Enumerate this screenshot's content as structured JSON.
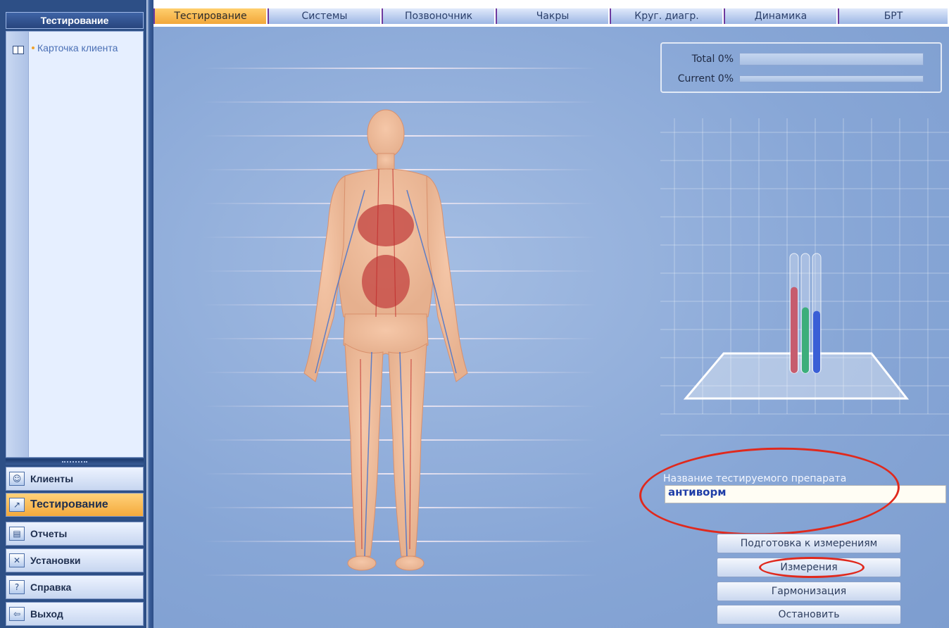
{
  "sidebar": {
    "header": "Тестирование",
    "tree_item": "Карточка клиента",
    "nav": [
      {
        "label": "Клиенты",
        "icon": "clients-icon"
      },
      {
        "label": "Тестирование",
        "icon": "testing-chart-icon"
      },
      {
        "label": "Отчеты",
        "icon": "printer-icon"
      },
      {
        "label": "Установки",
        "icon": "tools-icon"
      },
      {
        "label": "Справка",
        "icon": "help-icon"
      },
      {
        "label": "Выход",
        "icon": "exit-icon"
      }
    ],
    "active_nav_index": 1
  },
  "tabs": [
    "Тестирование",
    "Системы",
    "Позвоночник",
    "Чакры",
    "Круг. диагр.",
    "Динамика",
    "БРТ"
  ],
  "active_tab_index": 0,
  "progress": {
    "total_label": "Total 0%",
    "current_label": "Current 0%",
    "total_value": 0,
    "current_value": 0
  },
  "test_tubes": {
    "colors": [
      "#c65c6e",
      "#3cae7a",
      "#3a5fd6"
    ],
    "levels": [
      0.72,
      0.55,
      0.52
    ]
  },
  "drug": {
    "label": "Название тестируемого препарата",
    "value": "антиворм"
  },
  "buttons": {
    "prepare": "Подготовка к измерениям",
    "measure": "Измерения",
    "harmonize": "Гармонизация",
    "stop": "Остановить"
  },
  "colors": {
    "accent_orange": "#f2a73a",
    "annotation_red": "#e0291d",
    "panel_blue": "#87a6d6"
  }
}
